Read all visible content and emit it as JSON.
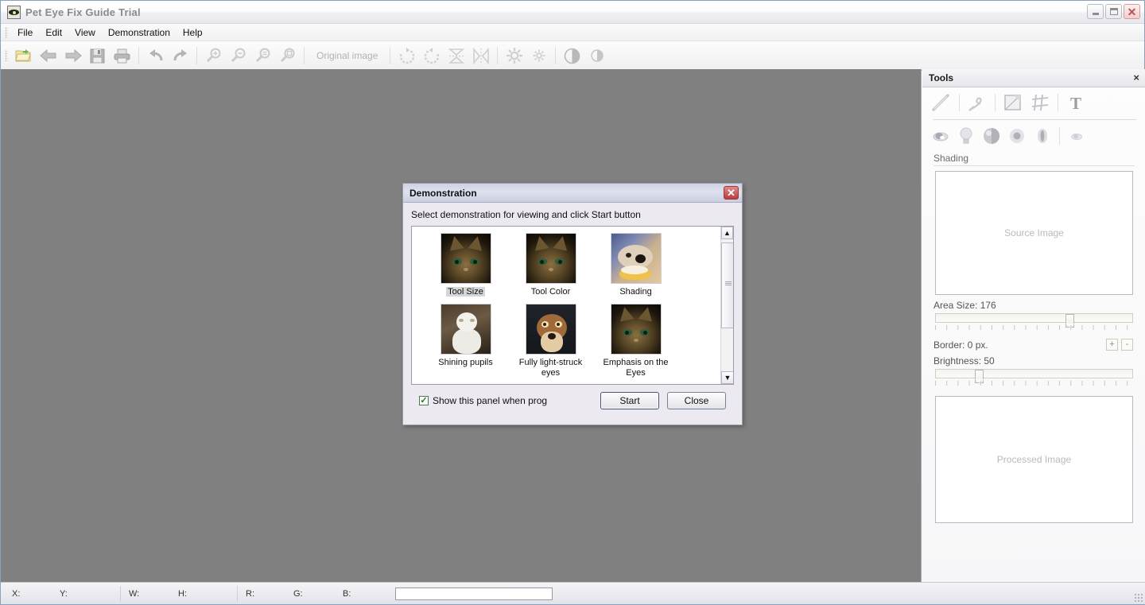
{
  "window": {
    "title": "Pet Eye Fix Guide Trial",
    "app_icon": "pet-eye-icon",
    "buttons": {
      "minimize": "minimize",
      "maximize": "maximize",
      "close": "close"
    }
  },
  "menubar": {
    "items": [
      "File",
      "Edit",
      "View",
      "Demonstration",
      "Help"
    ]
  },
  "toolbar": {
    "original_image_label": "Original image",
    "buttons": [
      "open-folder-icon",
      "back-arrow-icon",
      "forward-arrow-icon",
      "save-icon",
      "print-icon",
      "undo-icon",
      "redo-icon",
      "zoom-in-icon",
      "zoom-out-icon",
      "zoom-fit-icon",
      "zoom-actual-icon",
      "rotate-cw-icon",
      "rotate-ccw-icon",
      "flip-vertical-icon",
      "flip-horizontal-icon",
      "brightness-icon",
      "brightness-small-icon",
      "contrast-icon",
      "contrast-half-icon"
    ]
  },
  "tools_panel": {
    "title": "Tools",
    "close_label": "×",
    "row1_icons": [
      "line-tool-icon",
      "pencil-tool-icon",
      "crop-tool-icon",
      "grid-tool-icon",
      "text-tool-icon"
    ],
    "row2_icons": [
      "eye-tool-icon",
      "bulb-tool-icon",
      "sphere-shading-icon",
      "pupil-tool-icon",
      "glare-tool-icon",
      "eye-small-icon"
    ],
    "section_label": "Shading",
    "source_image_placeholder": "Source Image",
    "processed_image_placeholder": "Processed Image",
    "area_size_label": "Area Size: 176",
    "area_size_value": 176,
    "area_size_percent": 68,
    "border_label": "Border: 0 px.",
    "border_plus": "+",
    "border_minus": "-",
    "brightness_label": "Brightness: 50",
    "brightness_value": 50,
    "brightness_percent": 22
  },
  "dialog": {
    "title": "Demonstration",
    "close_label": "✕",
    "hint": "Select demonstration for viewing and click Start button",
    "items": [
      {
        "label": "Tool Size",
        "thumb": "cat-dark-tabby",
        "selected": true
      },
      {
        "label": "Tool Color",
        "thumb": "cat-dark-tabby",
        "selected": false
      },
      {
        "label": "Shading",
        "thumb": "dog-on-blanket",
        "selected": false
      },
      {
        "label": "Shining pupils",
        "thumb": "white-persian-cat",
        "selected": false
      },
      {
        "label": "Fully light-struck eyes",
        "thumb": "brown-dog",
        "selected": false
      },
      {
        "label": "Emphasis on the Eyes",
        "thumb": "cat-dark-tabby",
        "selected": false
      }
    ],
    "checkbox": {
      "label": "Show this panel when prog",
      "checked": true
    },
    "start_button": "Start",
    "close_button": "Close",
    "scrollbar": {
      "up": "▲",
      "down": "▼"
    }
  },
  "statusbar": {
    "fields": [
      {
        "name": "x",
        "label": "X:",
        "value": ""
      },
      {
        "name": "y",
        "label": "Y:",
        "value": ""
      },
      {
        "name": "w",
        "label": "W:",
        "value": ""
      },
      {
        "name": "h",
        "label": "H:",
        "value": ""
      },
      {
        "name": "r",
        "label": "R:",
        "value": ""
      },
      {
        "name": "g",
        "label": "G:",
        "value": ""
      },
      {
        "name": "b",
        "label": "B:",
        "value": ""
      }
    ],
    "message_value": "",
    "message_placeholder": ""
  },
  "colors": {
    "canvas": "#808080",
    "titlebar_text": "#8a8a8a",
    "dialog_title_grad": "#cdd2e4",
    "close_red": "#b83f3f"
  }
}
